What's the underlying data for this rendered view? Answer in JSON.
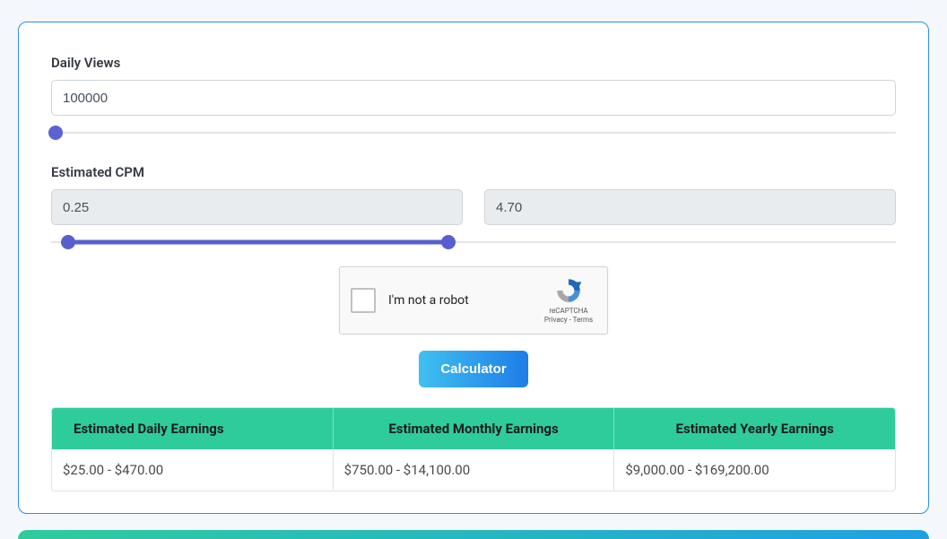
{
  "daily_views": {
    "label": "Daily Views",
    "value": "100000",
    "slider_pos_pct": 0
  },
  "cpm": {
    "label": "Estimated CPM",
    "low": "0.25",
    "high": "4.70",
    "slider_low_pct": 2,
    "slider_high_pct": 47
  },
  "recaptcha": {
    "label": "I'm not a robot",
    "brand": "reCAPTCHA",
    "links": "Privacy - Terms"
  },
  "button": {
    "label": "Calculator"
  },
  "results": {
    "headers": [
      "Estimated Daily Earnings",
      "Estimated Monthly Earnings",
      "Estimated Yearly Earnings"
    ],
    "values": [
      "$25.00 - $470.00",
      "$750.00 - $14,100.00",
      "$9,000.00 - $169,200.00"
    ]
  }
}
